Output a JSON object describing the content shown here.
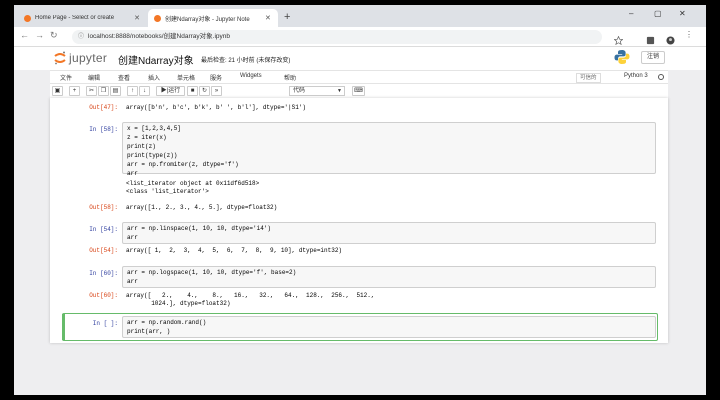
{
  "browser": {
    "tabs": [
      {
        "title": "Home Page - Select or create",
        "active": false
      },
      {
        "title": "创建Ndarray对象 - Jupyter Note",
        "active": true
      }
    ],
    "url": "localhost:8888/notebooks/创建Ndarray对象.ipynb"
  },
  "notebook": {
    "logo_text": "jupyter",
    "name": "创建Ndarray对象",
    "checkpoint": "最后检查: 21 小时前  (未保存改变)",
    "logout_label": "注销",
    "trusted_label": "可信的",
    "kernel_label": "Python 3"
  },
  "menubar": {
    "items": [
      "文件",
      "编辑",
      "查看",
      "插入",
      "单元格",
      "服务",
      "Widgets",
      "帮助"
    ]
  },
  "toolbar": {
    "run_label": "运行",
    "celltype": "代码"
  },
  "cells": [
    {
      "kind": "out",
      "prompt": "Out[47]:",
      "text": "array([b'n', b'c', b'k', b' ', b'l'], dtype='|S1')"
    },
    {
      "kind": "in",
      "prompt": "In [58]:",
      "code": [
        "x = [1,2,3,4,5]",
        "z = iter(x)",
        "print(z)",
        "print(type(z))",
        "arr = np.fromiter(z, dtype='f')",
        "arr"
      ]
    },
    {
      "kind": "stream",
      "text": [
        "<list_iterator object at 0x11df6d518>",
        "<class 'list_iterator'>"
      ]
    },
    {
      "kind": "out",
      "prompt": "Out[58]:",
      "text": "array([1., 2., 3., 4., 5.], dtype=float32)"
    },
    {
      "kind": "in",
      "prompt": "In [54]:",
      "code": [
        "arr = np.linspace(1, 10, 10, dtype='i4')",
        "arr"
      ]
    },
    {
      "kind": "out",
      "prompt": "Out[54]:",
      "text": "array([ 1,  2,  3,  4,  5,  6,  7,  8,  9, 10], dtype=int32)"
    },
    {
      "kind": "in",
      "prompt": "In [60]:",
      "code": [
        "arr = np.logspace(1, 10, 10, dtype='f', base=2)",
        "arr"
      ]
    },
    {
      "kind": "out",
      "prompt": "Out[60]:",
      "text": [
        "array([   2.,    4.,    8.,   16.,   32.,   64.,  128.,  256.,  512.,",
        "       1024.], dtype=float32)"
      ]
    },
    {
      "kind": "in",
      "prompt": "In [ ]:",
      "code": [
        "arr = np.random.rand()",
        "print(arr, )"
      ],
      "selected": true
    }
  ],
  "colors": {
    "in_prompt": "#303f9f",
    "out_prompt": "#d84315",
    "selected": "#66bb6a"
  }
}
